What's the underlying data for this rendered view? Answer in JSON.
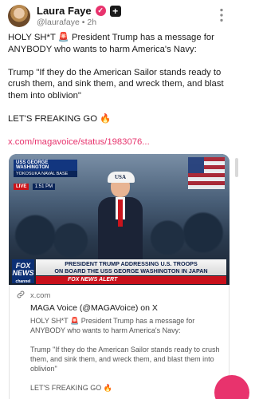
{
  "author": {
    "name": "Laura Faye",
    "handle": "@laurafaye",
    "time": "2h",
    "separator": "•",
    "verified_glyph": "✓",
    "follow_glyph": "+"
  },
  "post": {
    "paragraph1": "HOLY SH*T 🚨 President Trump has a message for ANYBODY who wants to harm America's Navy:",
    "paragraph2": "Trump \"If they do the American Sailor stands ready to crush them, and sink them, and wreck them, and blast them into oblivion\"",
    "paragraph3": "LET'S FREAKING GO 🔥",
    "link": "x.com/magavoice/status/1983076..."
  },
  "video": {
    "location_line1": "USS GEORGE WASHINGTON",
    "location_line2": "YOKOSUKA NAVAL BASE",
    "live_label": "LIVE",
    "live_time": "1:51 PM",
    "cap_text": "USA",
    "network_logo_line1": "FOX",
    "network_logo_line2": "NEWS",
    "network_logo_sub": "channel",
    "headline_line1": "PRESIDENT TRUMP ADDRESSING U.S. TROOPS",
    "headline_line2": "ON BOARD THE USS GEORGE WASHINGTON IN JAPAN",
    "alert_text": "FOX NEWS ALERT"
  },
  "link_card": {
    "domain": "x.com",
    "title": "MAGA Voice (@MAGAVoice) on X",
    "desc1": "HOLY SH*T 🚨 President Trump has a message for ANYBODY who wants to harm America's Navy:",
    "desc2": "Trump \"If they do the American Sailor stands ready to crush them, and sink them, and wreck them, and blast them into oblivion\"",
    "desc3": "LET'S FREAKING GO 🔥"
  },
  "colors": {
    "accent": "#e8336d",
    "link": "#e7336d",
    "muted": "#7a7a7a"
  },
  "icons": {
    "more": "more-options-icon",
    "link": "link-icon",
    "verified": "verified-icon"
  }
}
